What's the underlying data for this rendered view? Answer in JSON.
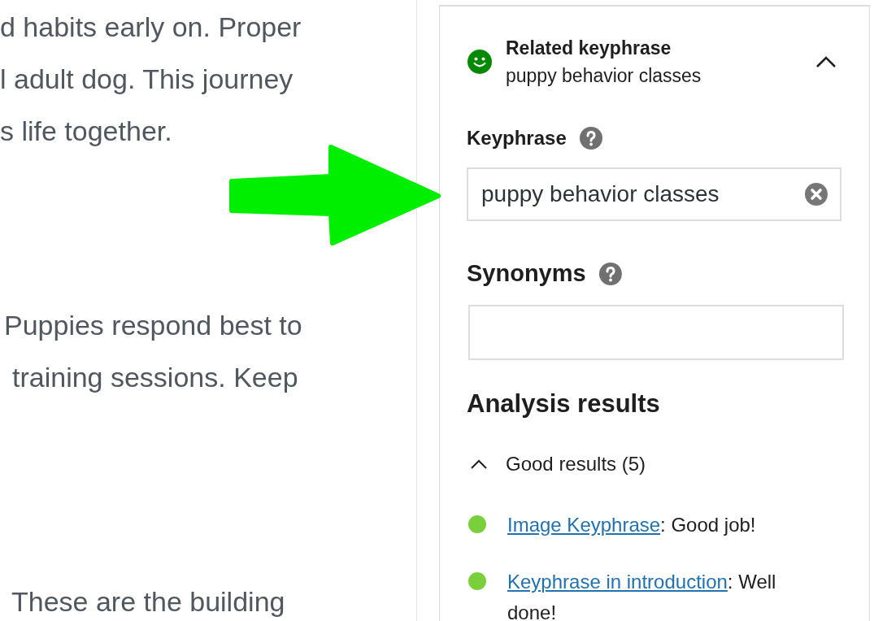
{
  "editor": {
    "paragraphs": [
      {
        "lines": [
          "d habits early on. Proper",
          "l adult dog. This journey",
          "s life together."
        ]
      },
      {
        "lines": [
          "Puppies respond best to",
          "training sessions. Keep"
        ]
      },
      {
        "lines": [
          "These are the building"
        ]
      }
    ]
  },
  "panel": {
    "header": {
      "title": "Related keyphrase",
      "subtitle": "puppy behavior classes",
      "expanded": true
    },
    "keyphrase": {
      "label": "Keyphrase",
      "value": "puppy behavior classes"
    },
    "synonyms": {
      "label": "Synonyms"
    },
    "analysis": {
      "heading": "Analysis results",
      "group": {
        "label": "Good results (5)",
        "expanded": true,
        "items": [
          {
            "color": "#7ad03a",
            "link": "Image Keyphrase",
            "text": ": Good job!"
          },
          {
            "color": "#7ad03a",
            "link": "Keyphrase in introduction",
            "text": ": Well done!"
          }
        ]
      }
    }
  }
}
